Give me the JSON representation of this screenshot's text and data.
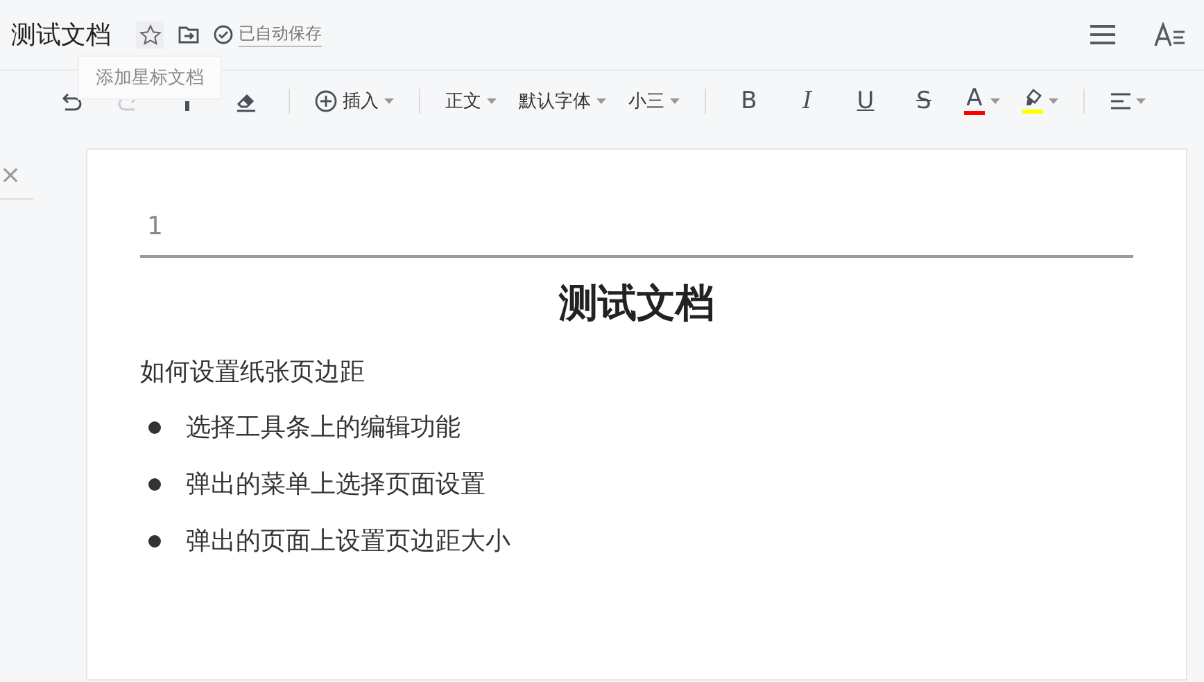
{
  "header": {
    "title": "测试文档",
    "starred": false,
    "save_status": "已自动保存",
    "tooltip": "添加星标文档"
  },
  "toolbar": [
    {
      "kind": "undo",
      "disabled": false
    },
    {
      "kind": "redo",
      "disabled": true
    },
    {
      "kind": "format-painter",
      "disabled": false
    },
    {
      "kind": "eraser",
      "disabled": false
    },
    {
      "kind": "sep"
    },
    {
      "kind": "insert",
      "label": "插入"
    },
    {
      "kind": "sep"
    },
    {
      "kind": "dropdown",
      "label": "正文"
    },
    {
      "kind": "dropdown",
      "label": "默认字体"
    },
    {
      "kind": "dropdown",
      "label": "小三"
    },
    {
      "kind": "sep"
    },
    {
      "kind": "bold",
      "label": "B"
    },
    {
      "kind": "italic",
      "label": "I"
    },
    {
      "kind": "underline",
      "label": "U"
    },
    {
      "kind": "strike",
      "label": "S"
    },
    {
      "kind": "font-color",
      "label": "A",
      "color": "#ff0000"
    },
    {
      "kind": "highlight",
      "color": "#ffff00"
    },
    {
      "kind": "sep"
    },
    {
      "kind": "align"
    }
  ],
  "side_panel": {
    "close": "×"
  },
  "document": {
    "header_text": "1",
    "title": "测试文档",
    "paragraph": "如何设置纸张页边距",
    "bullets": [
      "选择工具条上的编辑功能",
      "弹出的菜单上选择页面设置",
      "弹出的页面上设置页边距大小"
    ]
  }
}
